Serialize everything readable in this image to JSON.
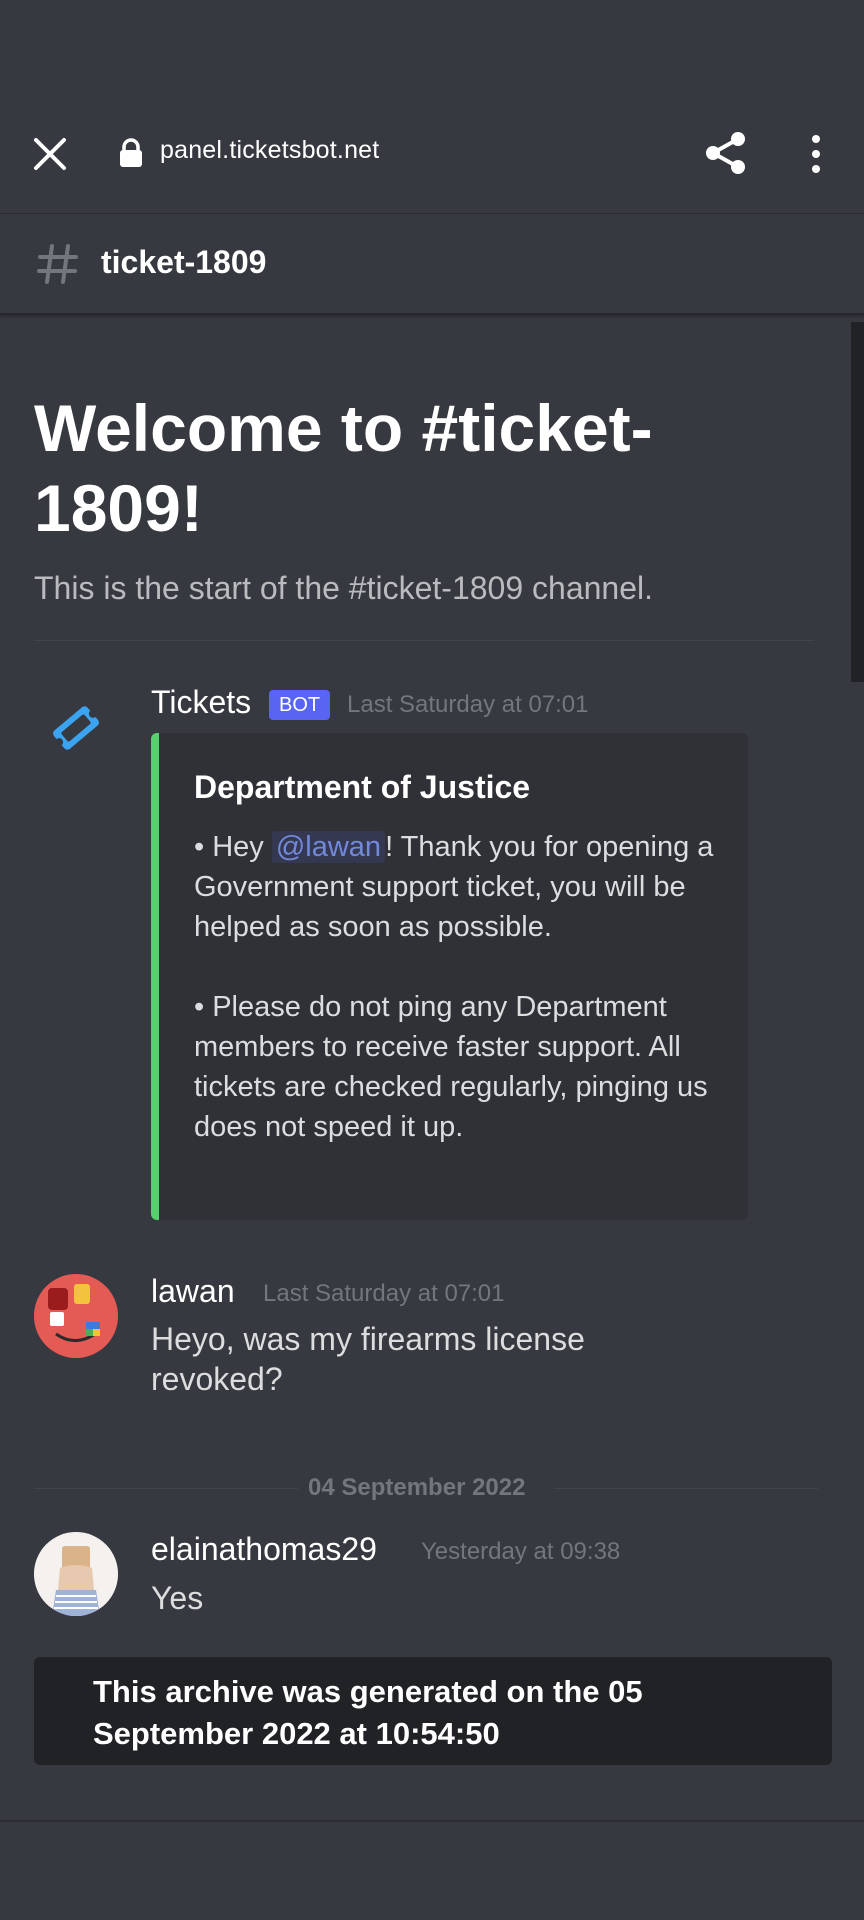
{
  "browser": {
    "url": "panel.ticketsbot.net"
  },
  "channel": {
    "name": "ticket-1809"
  },
  "welcome": {
    "title": "Welcome to #ticket-1809!",
    "subtitle": "This is the start of the #ticket-1809 channel."
  },
  "messages": [
    {
      "author": "Tickets",
      "badge": "BOT",
      "timestamp": "Last Saturday at 07:01",
      "embed": {
        "color": "#57cf6d",
        "title": "Department of Justice",
        "para1_prefix": "• Hey ",
        "mention": "@lawan",
        "para1_suffix": "! Thank you for opening a Government support ticket, you will be helped as soon as possible.",
        "para2": "• Please do not ping any Department members to receive faster support. All tickets are checked regularly, pinging us does not speed it up."
      }
    },
    {
      "author": "lawan",
      "timestamp": "Last Saturday at 07:01",
      "text": "Heyo, was my firearms license revoked?"
    },
    {
      "author": "elainathomas29",
      "timestamp": "Yesterday at 09:38",
      "text": "Yes"
    }
  ],
  "date_separator": "04 September 2022",
  "archive_notice": "This archive was generated on the 05 September 2022 at 10:54:50",
  "icons": {
    "close": "close-icon",
    "lock": "lock-icon",
    "share": "share-icon",
    "menu": "more-vert-icon",
    "channel": "hash-icon"
  }
}
